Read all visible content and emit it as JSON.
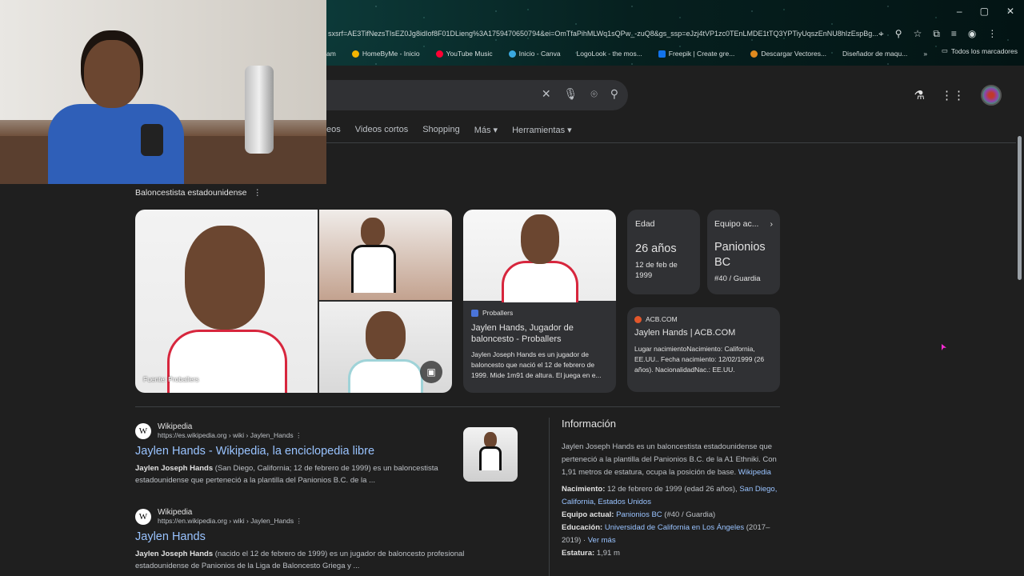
{
  "browser": {
    "url": "sxsrf=AE3TifNezsTIsEZ0Jg8idIof8F01DLieng%3A1759470650794&ei=OmTfaPihMLWq1sQPw_-zuQ8&gs_ssp=eJzj4tVP1zc0TEnLMDE1tTQ3YPTiyUqszEnNU8hIzEspBg...",
    "bookmarks": [
      "am",
      "HomeByMe - Inicio",
      "YouTube Music",
      "Inicio - Canva",
      "LogoLook - the mos...",
      "Freepik | Create gre...",
      "Descargar Vectores...",
      "Diseñador de maqu..."
    ],
    "bookmarks_more": "»",
    "all_bookmarks": "Todos los marcadores"
  },
  "tabs": [
    "eos",
    "Videos cortos",
    "Shopping",
    "Más ▾",
    "Herramientas ▾"
  ],
  "kp": {
    "subtitle": "Baloncestista estadounidense",
    "image_source": "Fuente: Proballers",
    "proballers": {
      "site": "Proballers",
      "title": "Jaylen Hands, Jugador de baloncesto - Proballers",
      "snippet": "Jaylen Joseph Hands es un jugador de baloncesto que nació el 12 de febrero de 1999. Mide 1m91 de altura. El juega en e..."
    },
    "age": {
      "label": "Edad",
      "value": "26 años",
      "sub": "12 de feb de 1999"
    },
    "team": {
      "label": "Equipo ac...",
      "value": "Panionios BC",
      "sub": "#40 / Guardia"
    },
    "acb": {
      "site": "ACB.COM",
      "title": "Jaylen Hands | ACB.COM",
      "snippet": "Lugar nacimientoNacimiento: California, EE.UU.. Fecha nacimiento: 12/02/1999 (26 años). NacionalidadNac.: EE.UU."
    }
  },
  "results": [
    {
      "site": "Wikipedia",
      "url": "https://es.wikipedia.org › wiki › Jaylen_Hands",
      "title": "Jaylen Hands - Wikipedia, la enciclopedia libre",
      "snippet_bold": "Jaylen Joseph Hands",
      "snippet": " (San Diego, California; 12 de febrero de 1999) es un baloncestista estadounidense que perteneció a la plantilla del Panionios B.C. de la ..."
    },
    {
      "site": "Wikipedia",
      "url": "https://en.wikipedia.org › wiki › Jaylen_Hands",
      "title": "Jaylen Hands",
      "snippet_bold": "Jaylen Joseph Hands",
      "snippet": " (nacido el 12 de febrero de 1999) es un jugador de baloncesto profesional estadounidense de Panionios de la Liga de Baloncesto Griega y ..."
    }
  ],
  "info": {
    "heading": "Información",
    "desc": "Jaylen Joseph Hands es un baloncestista estadounidense que perteneció a la plantilla del Panionios B.C. de la A1 Ethniki. Con 1,91 metros de estatura, ocupa la posición de base.",
    "desc_link": "Wikipedia",
    "birth_label": "Nacimiento:",
    "birth_value": "12 de febrero de 1999 (edad 26 años),",
    "birth_link": "San Diego, California, Estados Unidos",
    "team_label": "Equipo actual:",
    "team_link": "Panionios BC",
    "team_rest": "(#40 / Guardia)",
    "edu_label": "Educación:",
    "edu_link": "Universidad de California en Los Ángeles",
    "edu_rest": "(2017–2019) ·",
    "edu_more": "Ver más",
    "height_label": "Estatura:",
    "height_value": "1,91 m"
  },
  "colors": {
    "background": "#1f1f1f",
    "card": "#303134",
    "link": "#99c3ff",
    "accent_red": "#d7263d"
  }
}
